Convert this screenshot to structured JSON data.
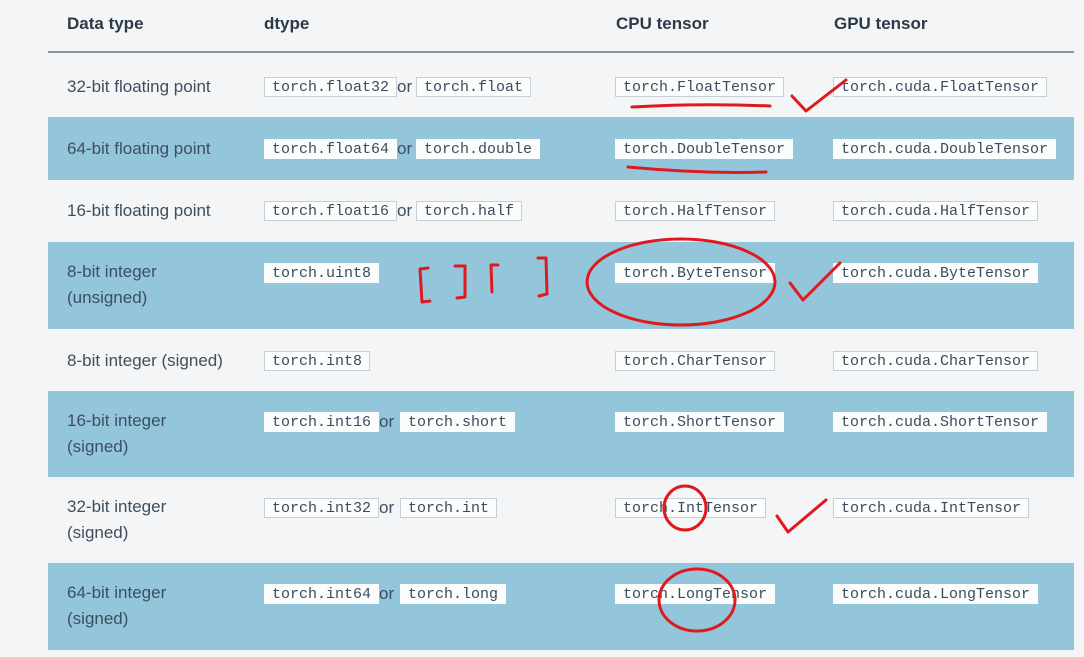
{
  "headers": {
    "data_type": "Data type",
    "dtype": "dtype",
    "cpu": "CPU tensor",
    "gpu": "GPU tensor"
  },
  "or_word": "or",
  "rows": [
    {
      "label_lines": [
        "32-bit floating point"
      ],
      "dtypes": [
        "torch.float32",
        "torch.float"
      ],
      "cpu": "torch.FloatTensor",
      "gpu": "torch.cuda.FloatTensor"
    },
    {
      "label_lines": [
        "64-bit floating point"
      ],
      "dtypes": [
        "torch.float64",
        "torch.double"
      ],
      "cpu": "torch.DoubleTensor",
      "gpu": "torch.cuda.DoubleTensor"
    },
    {
      "label_lines": [
        "16-bit floating point"
      ],
      "dtypes": [
        "torch.float16",
        "torch.half"
      ],
      "cpu": "torch.HalfTensor",
      "gpu": "torch.cuda.HalfTensor"
    },
    {
      "label_lines": [
        "8-bit integer",
        "(unsigned)"
      ],
      "dtypes": [
        "torch.uint8"
      ],
      "cpu": "torch.ByteTensor",
      "gpu": "torch.cuda.ByteTensor"
    },
    {
      "label_lines": [
        "8-bit integer (signed)"
      ],
      "dtypes": [
        "torch.int8"
      ],
      "cpu": "torch.CharTensor",
      "gpu": "torch.cuda.CharTensor"
    },
    {
      "label_lines": [
        "16-bit integer",
        "(signed)"
      ],
      "dtypes": [
        "torch.int16",
        "torch.short"
      ],
      "cpu": "torch.ShortTensor",
      "gpu": "torch.cuda.ShortTensor"
    },
    {
      "label_lines": [
        "32-bit integer",
        "(signed)"
      ],
      "dtypes": [
        "torch.int32",
        "torch.int"
      ],
      "cpu": "torch.IntTensor",
      "gpu": "torch.cuda.IntTensor"
    },
    {
      "label_lines": [
        "64-bit integer",
        "(signed)"
      ],
      "dtypes": [
        "torch.int64",
        "torch.long"
      ],
      "cpu": "torch.LongTensor",
      "gpu": "torch.cuda.LongTensor"
    }
  ],
  "colors": {
    "shaded_row": "#94c6db",
    "ink": "#e0191f",
    "code_bg": "#fbfcfc"
  }
}
